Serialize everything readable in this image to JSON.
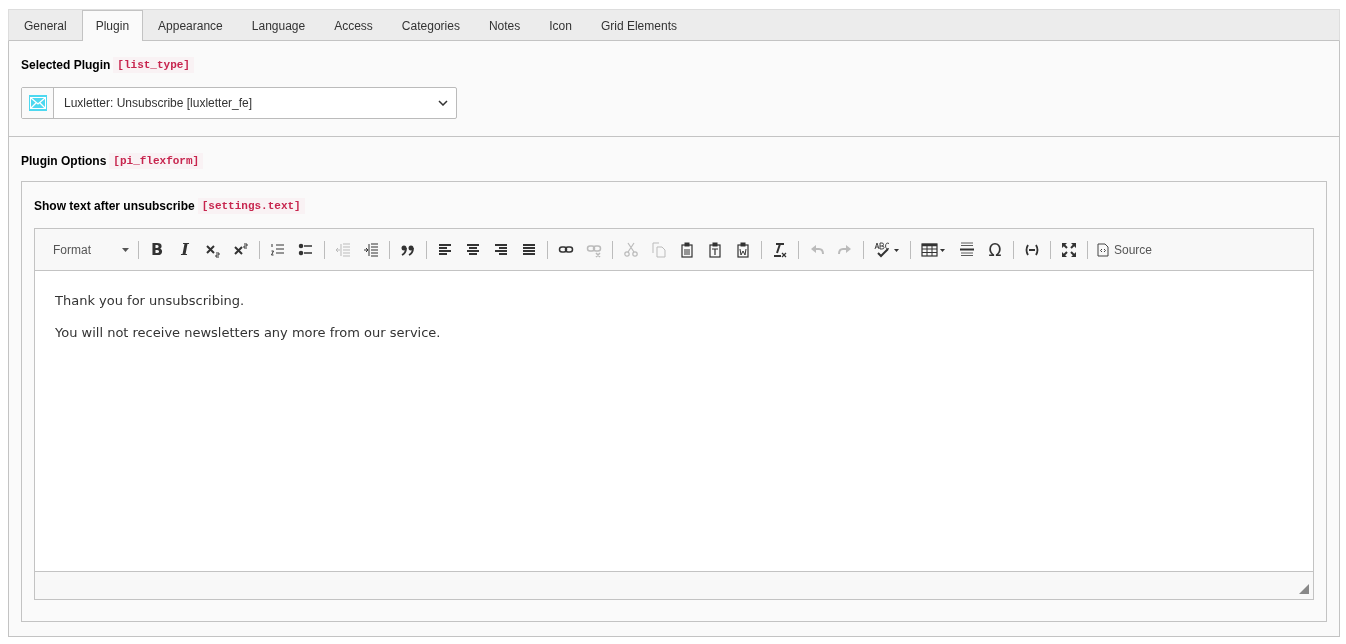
{
  "tabs": [
    {
      "label": "General",
      "selected": false
    },
    {
      "label": "Plugin",
      "selected": true
    },
    {
      "label": "Appearance",
      "selected": false
    },
    {
      "label": "Language",
      "selected": false
    },
    {
      "label": "Access",
      "selected": false
    },
    {
      "label": "Categories",
      "selected": false
    },
    {
      "label": "Notes",
      "selected": false
    },
    {
      "label": "Icon",
      "selected": false
    },
    {
      "label": "Grid Elements",
      "selected": false
    }
  ],
  "selected_plugin": {
    "label": "Selected Plugin",
    "field_name": "[list_type]",
    "value": "Luxletter: Unsubscribe [luxletter_fe]"
  },
  "plugin_options": {
    "label": "Plugin Options",
    "field_name": "[pi_flexform]",
    "field": {
      "label": "Show text after unsubscribe",
      "field_name": "[settings.text]",
      "toolbar": [
        [
          {
            "kind": "format",
            "label": "Format",
            "disabled": false
          }
        ],
        [
          {
            "kind": "bold",
            "glyph": "B",
            "disabled": false
          },
          {
            "kind": "italic",
            "glyph": "I",
            "disabled": false
          },
          {
            "kind": "subscript",
            "disabled": false
          },
          {
            "kind": "superscript",
            "disabled": false
          }
        ],
        [
          {
            "kind": "numbered-list",
            "disabled": false
          },
          {
            "kind": "bulleted-list",
            "disabled": false
          }
        ],
        [
          {
            "kind": "outdent",
            "disabled": true
          },
          {
            "kind": "indent",
            "disabled": false
          }
        ],
        [
          {
            "kind": "blockquote",
            "disabled": false
          }
        ],
        [
          {
            "kind": "align-left",
            "disabled": false
          },
          {
            "kind": "align-center",
            "disabled": false
          },
          {
            "kind": "align-right",
            "disabled": false
          },
          {
            "kind": "justify",
            "disabled": false
          }
        ],
        [
          {
            "kind": "link",
            "disabled": false
          },
          {
            "kind": "unlink",
            "disabled": true
          }
        ],
        [
          {
            "kind": "cut",
            "disabled": true
          },
          {
            "kind": "copy",
            "disabled": true
          },
          {
            "kind": "paste",
            "disabled": false
          },
          {
            "kind": "paste-text",
            "disabled": false
          },
          {
            "kind": "paste-word",
            "disabled": false
          }
        ],
        [
          {
            "kind": "remove-format",
            "disabled": false
          }
        ],
        [
          {
            "kind": "undo",
            "disabled": true
          },
          {
            "kind": "redo",
            "disabled": true
          }
        ],
        [
          {
            "kind": "spellcheck",
            "disabled": false
          }
        ],
        [
          {
            "kind": "table",
            "disabled": false
          },
          {
            "kind": "horizontal-line",
            "disabled": false
          },
          {
            "kind": "special-char",
            "glyph": "Ω",
            "disabled": false
          }
        ],
        [
          {
            "kind": "iframe",
            "disabled": false
          }
        ],
        [
          {
            "kind": "maximize",
            "disabled": false
          }
        ],
        [
          {
            "kind": "source",
            "label": "Source",
            "disabled": false
          }
        ]
      ],
      "paragraphs": [
        "Thank you for unsubscribing.",
        "You will not receive newsletters any more from our service."
      ]
    }
  }
}
